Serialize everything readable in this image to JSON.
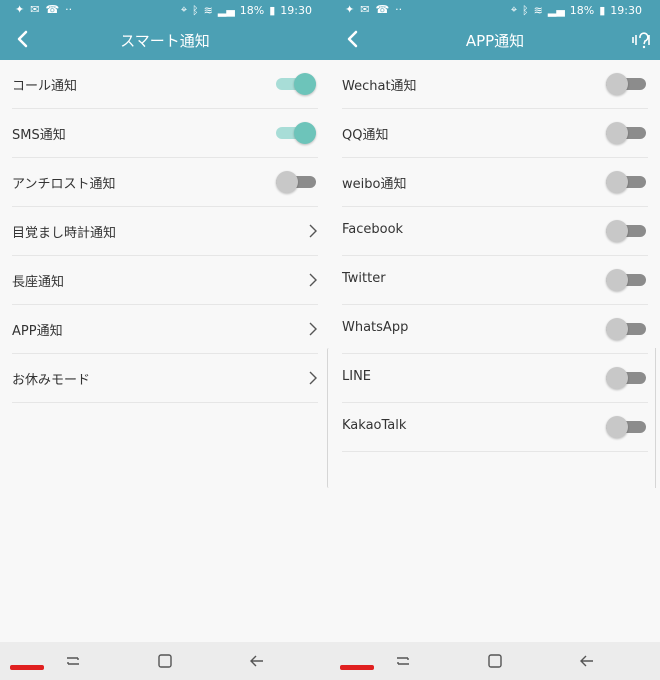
{
  "status": {
    "battery": "18%",
    "time": "19:30"
  },
  "left": {
    "title": "スマート通知",
    "items": [
      {
        "label": "コール通知",
        "control": "toggle",
        "on": true
      },
      {
        "label": "SMS通知",
        "control": "toggle",
        "on": true
      },
      {
        "label": "アンチロスト通知",
        "control": "toggle",
        "on": false
      },
      {
        "label": "目覚まし時計通知",
        "control": "chevron"
      },
      {
        "label": "長座通知",
        "control": "chevron"
      },
      {
        "label": "APP通知",
        "control": "chevron"
      },
      {
        "label": "お休みモード",
        "control": "chevron"
      }
    ]
  },
  "right": {
    "title": "APP通知",
    "items": [
      {
        "label": "Wechat通知",
        "control": "toggle",
        "on": false
      },
      {
        "label": "QQ通知",
        "control": "toggle",
        "on": false
      },
      {
        "label": "weibo通知",
        "control": "toggle",
        "on": false
      },
      {
        "label": "Facebook",
        "control": "toggle",
        "on": false
      },
      {
        "label": "Twitter",
        "control": "toggle",
        "on": false
      },
      {
        "label": "WhatsApp",
        "control": "toggle",
        "on": false
      },
      {
        "label": "LINE",
        "control": "toggle",
        "on": false
      },
      {
        "label": "KakaoTalk",
        "control": "toggle",
        "on": false
      }
    ]
  },
  "colors": {
    "accent": "#4ca0b4",
    "toggle_on": "#6dc4ba",
    "toggle_off": "#c8c8c8"
  },
  "icons": [
    "back-arrow-icon",
    "sound-settings-icon",
    "chevron-right-icon",
    "recents-icon",
    "home-icon",
    "back-nav-icon"
  ]
}
